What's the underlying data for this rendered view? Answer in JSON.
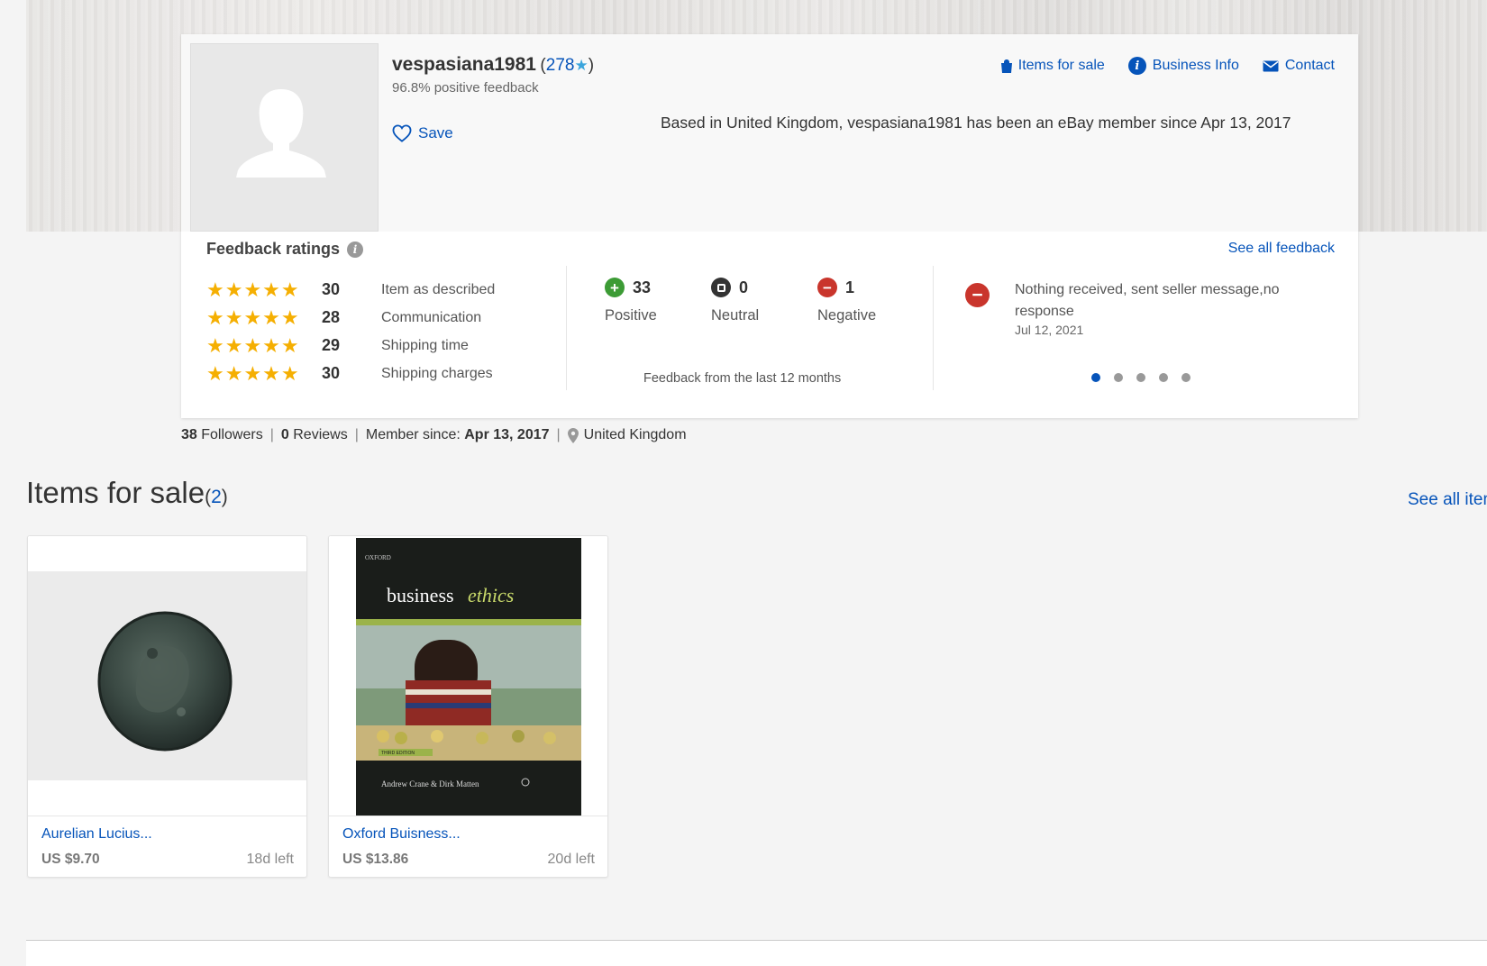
{
  "profile": {
    "username": "vespasiana1981",
    "score_open": "(",
    "feedback_score": "278",
    "score_star": "★",
    "score_close": ")",
    "positive_feedback": "96.8% positive feedback",
    "save_label": "Save",
    "description": "Based in United Kingdom, vespasiana1981 has been an eBay member since Apr 13, 2017"
  },
  "header_links": {
    "items_for_sale": "Items for sale",
    "business_info": "Business Info",
    "contact": "Contact"
  },
  "feedback": {
    "title": "Feedback ratings",
    "see_all": "See all feedback",
    "dsr": [
      {
        "stars": 5,
        "count": "30",
        "label": "Item as described"
      },
      {
        "stars": 5,
        "count": "28",
        "label": "Communication"
      },
      {
        "stars": 5,
        "count": "29",
        "label": "Shipping time"
      },
      {
        "stars": 5,
        "count": "30",
        "label": "Shipping charges"
      }
    ],
    "positive": {
      "count": "33",
      "label": "Positive"
    },
    "neutral": {
      "count": "0",
      "label": "Neutral"
    },
    "negative": {
      "count": "1",
      "label": "Negative"
    },
    "period_note": "Feedback from the last 12 months",
    "recent": {
      "type": "negative",
      "text": "Nothing received, sent seller message,no response",
      "date": "Jul 12, 2021"
    },
    "carousel": {
      "total": 5,
      "active": 1
    }
  },
  "stats": {
    "followers_count": "38",
    "followers_label": "Followers",
    "reviews_count": "0",
    "reviews_label": "Reviews",
    "member_since_label": "Member since:",
    "member_since": "Apr 13, 2017",
    "location": "United Kingdom",
    "separator": "|"
  },
  "items_section": {
    "title": "Items for sale",
    "count_open": "(",
    "count": "2",
    "count_close": ")",
    "see_all": "See all items",
    "items": [
      {
        "title": "Aurelian Lucius...",
        "price": "US $9.70",
        "time_left": "18d left"
      },
      {
        "title": "Oxford Buisness...",
        "price": "US $13.86",
        "time_left": "20d left"
      }
    ]
  },
  "book_cover": {
    "publisher": "OXFORD",
    "title_a": "business",
    "title_b": "ethics",
    "edition": "THIRD EDITION",
    "authors": "Andrew Crane & Dirk Matten"
  },
  "colors": {
    "link": "#0654ba",
    "star": "#f5af02",
    "positive": "#3c9b35",
    "negative": "#c9352c",
    "neutral": "#333333"
  }
}
